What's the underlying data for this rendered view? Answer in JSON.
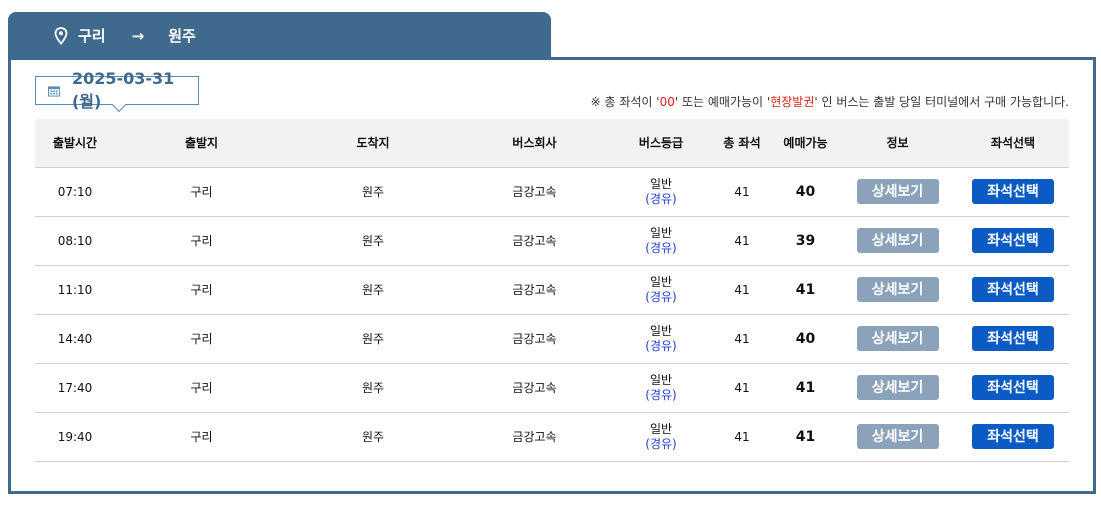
{
  "route": {
    "origin": "구리",
    "arrow": "→",
    "destination": "원주"
  },
  "date": {
    "label": "2025-03-31 (월)"
  },
  "notice": {
    "prefix": "※ 총 좌석이 '",
    "code1": "00",
    "middle": "' 또는 예매가능이 '",
    "code2": "현장발권",
    "suffix": "' 인 버스는 출발 당일 터미널에서 구매 가능합니다."
  },
  "table": {
    "headers": [
      "출발시간",
      "출발지",
      "도착지",
      "버스회사",
      "버스등급",
      "총 좌석",
      "예매가능",
      "정보",
      "좌석선택"
    ],
    "rows": [
      {
        "time": "07:10",
        "from": "구리",
        "to": "원주",
        "company": "금강고속",
        "grade": "일반",
        "route_type": "(경유)",
        "total": "41",
        "available": "40",
        "detail": "상세보기",
        "seat": "좌석선택"
      },
      {
        "time": "08:10",
        "from": "구리",
        "to": "원주",
        "company": "금강고속",
        "grade": "일반",
        "route_type": "(경유)",
        "total": "41",
        "available": "39",
        "detail": "상세보기",
        "seat": "좌석선택"
      },
      {
        "time": "11:10",
        "from": "구리",
        "to": "원주",
        "company": "금강고속",
        "grade": "일반",
        "route_type": "(경유)",
        "total": "41",
        "available": "41",
        "detail": "상세보기",
        "seat": "좌석선택"
      },
      {
        "time": "14:40",
        "from": "구리",
        "to": "원주",
        "company": "금강고속",
        "grade": "일반",
        "route_type": "(경유)",
        "total": "41",
        "available": "40",
        "detail": "상세보기",
        "seat": "좌석선택"
      },
      {
        "time": "17:40",
        "from": "구리",
        "to": "원주",
        "company": "금강고속",
        "grade": "일반",
        "route_type": "(경유)",
        "total": "41",
        "available": "41",
        "detail": "상세보기",
        "seat": "좌석선택"
      },
      {
        "time": "19:40",
        "from": "구리",
        "to": "원주",
        "company": "금강고속",
        "grade": "일반",
        "route_type": "(경유)",
        "total": "41",
        "available": "41",
        "detail": "상세보기",
        "seat": "좌석선택"
      }
    ]
  },
  "colors": {
    "brand": "#3f6a8d",
    "notice_highlight": "#e0201a",
    "detail_button": "#8ba3ba",
    "seat_button": "#0c5bc4",
    "route_type": "#1f3fd0"
  },
  "icons": {
    "route_origin": "location-pin-icon",
    "route_arrow": "arrow-right-icon",
    "date": "calendar-icon"
  }
}
